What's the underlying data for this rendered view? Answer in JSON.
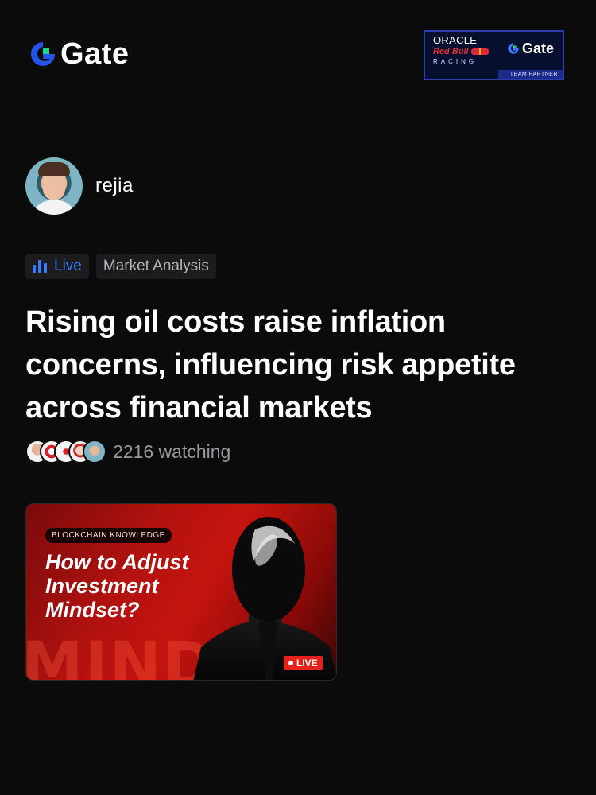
{
  "header": {
    "logo_text": "Gate",
    "partner": {
      "oracle": "ORACLE",
      "redbull": "Red Bull",
      "racing": "RACING",
      "gate": "Gate",
      "team_partner": "TEAM PARTNER"
    }
  },
  "author": {
    "name": "rejia"
  },
  "tags": {
    "live": "Live",
    "category": "Market Analysis"
  },
  "post": {
    "title": "Rising oil costs raise inflation concerns, influencing risk appetite across financial markets",
    "watching": "2216 watching"
  },
  "card": {
    "badge": "BLOCKCHAIN KNOWLEDGE",
    "heading": "How to Adjust Investment Mindset?",
    "bg_text": "MIND",
    "live_label": "LIVE"
  },
  "colors": {
    "background": "#0b0b0c",
    "accent_blue": "#3d7bfd",
    "logo_green": "#1fd18a",
    "card_red": "#c4140f"
  }
}
